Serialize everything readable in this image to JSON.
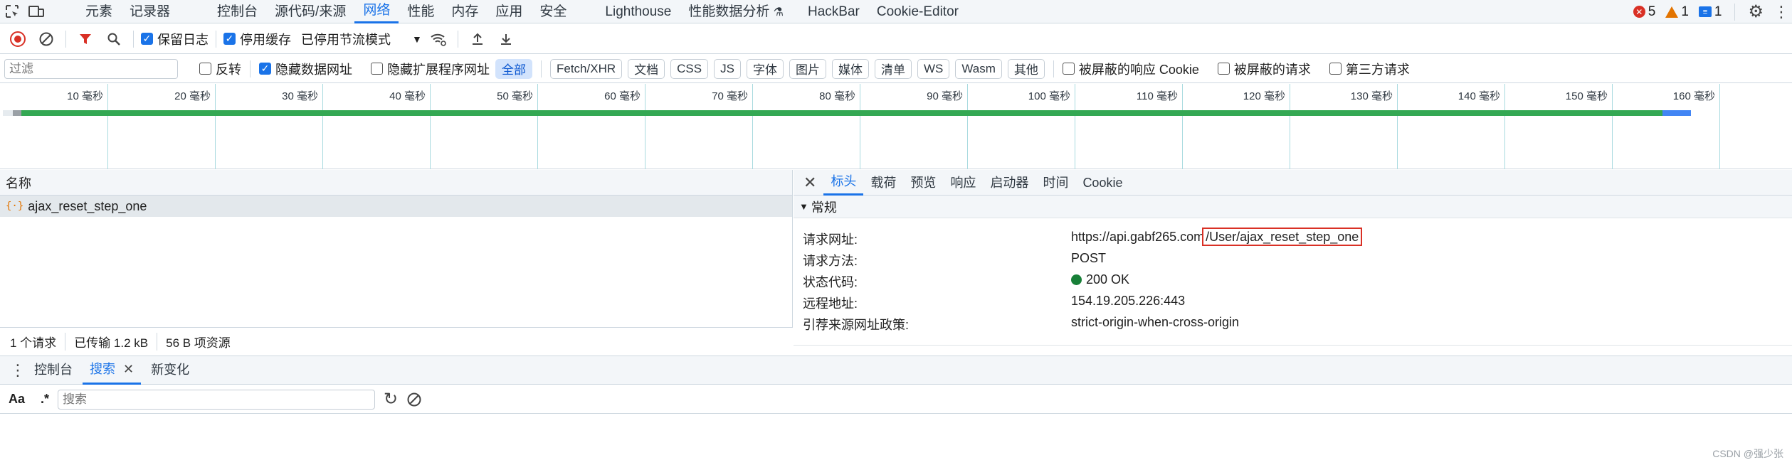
{
  "topbar": {
    "tabs": [
      "元素",
      "记录器",
      "控制台",
      "源代码/来源",
      "网络",
      "性能",
      "内存",
      "应用",
      "安全",
      "Lighthouse",
      "性能数据分析",
      "HackBar",
      "Cookie-Editor"
    ],
    "active_tab": "网络",
    "errors": "5",
    "warnings": "1",
    "messages": "1"
  },
  "toolbar": {
    "preserve_log": "保留日志",
    "disable_cache": "停用缓存",
    "throttle": "已停用节流模式"
  },
  "filter": {
    "placeholder": "过滤",
    "invert": "反转",
    "hide_data_urls": "隐藏数据网址",
    "hide_ext_urls": "隐藏扩展程序网址",
    "types": [
      "全部",
      "Fetch/XHR",
      "文档",
      "CSS",
      "JS",
      "字体",
      "图片",
      "媒体",
      "清单",
      "WS",
      "Wasm",
      "其他"
    ],
    "blocked_cookies": "被屏蔽的响应 Cookie",
    "blocked_requests": "被屏蔽的请求",
    "third_party": "第三方请求"
  },
  "timeline": {
    "ticks": [
      "10 毫秒",
      "20 毫秒",
      "30 毫秒",
      "40 毫秒",
      "50 毫秒",
      "60 毫秒",
      "70 毫秒",
      "80 毫秒",
      "90 毫秒",
      "100 毫秒",
      "110 毫秒",
      "120 毫秒",
      "130 毫秒",
      "140 毫秒",
      "150 毫秒",
      "160 毫秒"
    ]
  },
  "requests": {
    "header": "名称",
    "rows": [
      {
        "name": "ajax_reset_step_one"
      }
    ]
  },
  "status": {
    "count": "1 个请求",
    "transferred": "已传输 1.2 kB",
    "resources": "56 B 项资源"
  },
  "detail": {
    "tabs": [
      "标头",
      "载荷",
      "预览",
      "响应",
      "启动器",
      "时间",
      "Cookie"
    ],
    "active_tab": "标头",
    "section": "常规",
    "fields": {
      "url_label": "请求网址:",
      "url_host": "https://api.gabf265.com",
      "url_path": "/User/ajax_reset_step_one",
      "method_label": "请求方法:",
      "method": "POST",
      "status_label": "状态代码:",
      "status": "200 OK",
      "remote_label": "远程地址:",
      "remote": "154.19.205.226:443",
      "referrer_label": "引荐来源网址政策:",
      "referrer": "strict-origin-when-cross-origin"
    }
  },
  "drawer": {
    "tabs": [
      "控制台",
      "搜索",
      "新变化"
    ],
    "active_tab": "搜索",
    "case_toggle": "Aa",
    "regex_toggle": ".*",
    "search_placeholder": "搜索"
  },
  "watermark": "CSDN @强少张"
}
